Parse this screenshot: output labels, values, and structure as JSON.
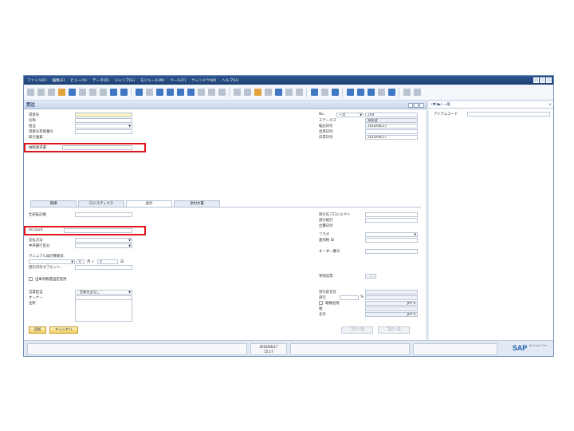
{
  "menubar": {
    "items": [
      "ファイル(F)",
      "編集(E)",
      "ビュー(V)",
      "データ(D)",
      "ジャンプ(G)",
      "モジュール(M)",
      "ツール(T)",
      "ウィンドウ(W)",
      "ヘルプ(H)"
    ]
  },
  "form": {
    "title": "受注",
    "left_labels": [
      "得意先",
      "名称",
      "担当",
      "得意先参照番号",
      "取引通貨"
    ],
    "invoice_label": "納税請求書",
    "right_labels": [
      "No.",
      "ステータス",
      "転記日付",
      "出荷日付",
      "伝票日付"
    ],
    "no_type": "一次",
    "no_value": "249",
    "status": "未処理",
    "posting_date": "2016/06/17",
    "doc_date": "2016/06/17",
    "tabs": [
      "明細",
      "ロジスティクス",
      "会計",
      "添付文書"
    ],
    "acc_labels": [
      "仕訳転記帳",
      "Account",
      "支払方法",
      "中央銀行区分",
      "マニュアル再計算期日:",
      "割引日付オフセット:"
    ],
    "month_label": "月 +",
    "month_value": "0",
    "day_label": "日",
    "day_value": "0",
    "chk_label": "出庫済数量固定使用",
    "right_acc_labels": [
      "割引先プロジェクト",
      "割引総計",
      "出費日付",
      "フラグ",
      "連邦税 ID",
      "オーダー番号"
    ],
    "ref_label": "参照伝票",
    "ref_button": "...",
    "sales_label": "営業担当",
    "sales_value": "- 営業担当なし -",
    "owner_label": "オーナー",
    "total_labels": [
      "割引前合計",
      "割引",
      "端数処理",
      "税",
      "合計"
    ],
    "percent": "%",
    "amount1": "JPY 0",
    "amount2": "JPY 0",
    "remarks_label": "注釈",
    "add_button": "追加",
    "cancel_button": "キャンセル",
    "copy_from": "コピー元",
    "copy_to": "コピー先"
  },
  "right_panel": {
    "header": "(▼)(▶) 一般",
    "item_label": "アイテムコード",
    "close": "×"
  },
  "status": {
    "date": "2016/06/17",
    "time": "15:17",
    "brand": "SAP",
    "brand_sub": "Business One"
  }
}
